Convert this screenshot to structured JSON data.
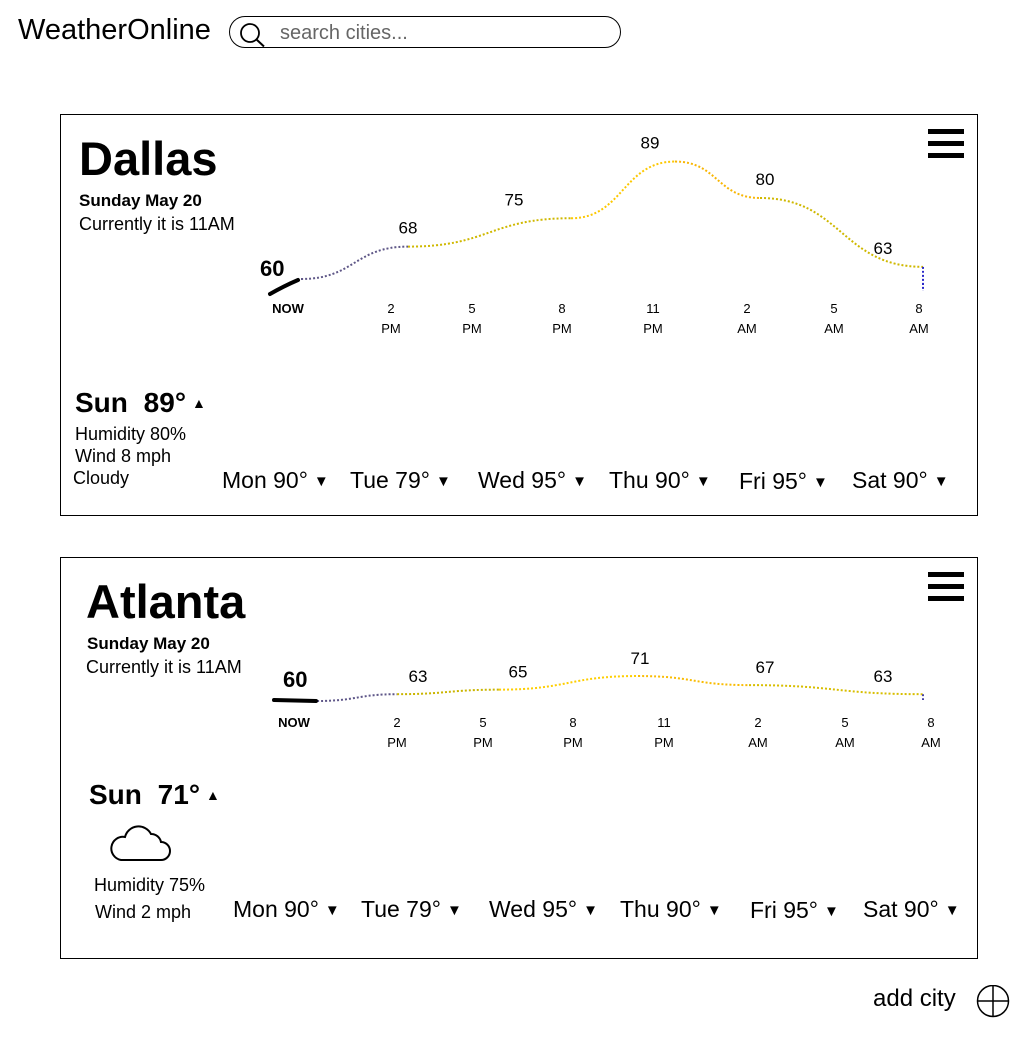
{
  "app": {
    "name": "WeatherOnline"
  },
  "search": {
    "placeholder": "search cities..."
  },
  "cities": [
    {
      "name": "Dallas",
      "date": "Sunday May 20",
      "current_time": "Currently it is 11AM",
      "today": {
        "label": "Sun",
        "temp": "89°"
      },
      "details": [
        "Humidity 80%",
        "Wind 8 mph",
        "Cloudy"
      ],
      "hourly": {
        "current_label": "60",
        "times": [
          [
            "NOW"
          ],
          [
            "2",
            "PM"
          ],
          [
            "5",
            "PM"
          ],
          [
            "8",
            "PM"
          ],
          [
            "11",
            "PM"
          ],
          [
            "2",
            "AM"
          ],
          [
            "5",
            "AM"
          ],
          [
            "8",
            "AM"
          ]
        ],
        "temps": [
          60,
          68,
          75,
          89,
          80,
          63
        ],
        "temp_labels": [
          "68",
          "75",
          "89",
          "80",
          "63"
        ]
      },
      "forecast": [
        {
          "day": "Mon",
          "temp": "90°"
        },
        {
          "day": "Tue",
          "temp": "79°"
        },
        {
          "day": "Wed",
          "temp": "95°"
        },
        {
          "day": "Thu",
          "temp": "90°"
        },
        {
          "day": "Fri",
          "temp": "95°"
        },
        {
          "day": "Sat",
          "temp": "90°"
        }
      ]
    },
    {
      "name": "Atlanta",
      "date": "Sunday May 20",
      "current_time": "Currently it is 11AM",
      "today": {
        "label": "Sun",
        "temp": "71°"
      },
      "weather_icon": "cloud-icon",
      "details": [
        "Humidity 75%",
        "Wind 2 mph"
      ],
      "hourly": {
        "current_label": "60",
        "times": [
          [
            "NOW"
          ],
          [
            "2",
            "PM"
          ],
          [
            "5",
            "PM"
          ],
          [
            "8",
            "PM"
          ],
          [
            "11",
            "PM"
          ],
          [
            "2",
            "AM"
          ],
          [
            "5",
            "AM"
          ],
          [
            "8",
            "AM"
          ]
        ],
        "temps": [
          60,
          63,
          65,
          71,
          67,
          63
        ],
        "temp_labels": [
          "63",
          "65",
          "71",
          "67",
          "63"
        ]
      },
      "forecast": [
        {
          "day": "Mon",
          "temp": "90°"
        },
        {
          "day": "Tue",
          "temp": "79°"
        },
        {
          "day": "Wed",
          "temp": "95°"
        },
        {
          "day": "Thu",
          "temp": "90°"
        },
        {
          "day": "Fri",
          "temp": "95°"
        },
        {
          "day": "Sat",
          "temp": "90°"
        }
      ]
    }
  ],
  "add_city": {
    "label": "add city",
    "icon": "plus-circle-icon"
  },
  "colors": {
    "cool": "#1a1adf",
    "mid": "#c8b400",
    "warm": "#ffd400",
    "hot": "#f0960a"
  }
}
